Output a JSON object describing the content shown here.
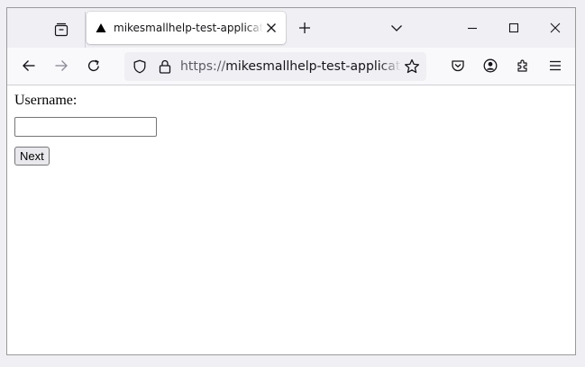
{
  "browser": {
    "tab": {
      "title": "mikesmallhelp-test-application",
      "favicon": "triangle-icon"
    },
    "url": {
      "scheme": "https://",
      "host": "mikesmallhelp-test-application-n"
    },
    "icons": {
      "tab_overview": "firefox-view-icon",
      "tab_close": "close-icon",
      "new_tab": "plus-icon",
      "list_tabs": "chevron-down-icon",
      "minimize": "minimize-icon",
      "maximize": "maximize-icon",
      "close_window": "close-icon",
      "back": "back-arrow-icon",
      "forward": "forward-arrow-icon",
      "reload": "reload-icon",
      "tracking_protection": "shield-icon",
      "secure": "lock-icon",
      "bookmark": "star-icon",
      "pocket": "pocket-icon",
      "account": "account-icon",
      "extensions": "puzzle-icon",
      "menu": "hamburger-menu-icon"
    },
    "colors": {
      "chrome_bg": "#f0f0f4",
      "navbar_bg": "#f9f9fb",
      "icon": "#15141a",
      "disabled_icon": "#8f8f9d"
    }
  },
  "page": {
    "username_label": "Username:",
    "username_value": "",
    "next_button_label": "Next"
  }
}
